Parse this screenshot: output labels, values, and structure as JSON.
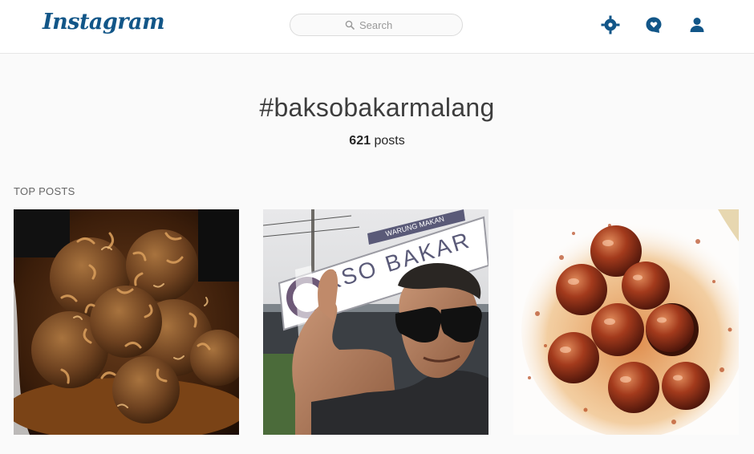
{
  "header": {
    "logo_text": "Instagram",
    "search_placeholder": "Search",
    "icons": [
      "explore-icon",
      "activity-icon",
      "profile-icon"
    ]
  },
  "tag": {
    "title": "#baksobakarmalang",
    "post_count": "621",
    "post_count_suffix": " posts"
  },
  "top_posts": {
    "label": "TOP POSTS",
    "items": [
      {
        "alt": "meatballs with fried shallots"
      },
      {
        "alt": "selfie in front of Bakso Bakar sign",
        "sign_small": "WARUNG MAKAN",
        "sign_large": "BAKSO BAKAR"
      },
      {
        "alt": "grilled meatballs with sauce"
      }
    ]
  },
  "colors": {
    "brand": "#125688",
    "background": "#fafafa"
  }
}
